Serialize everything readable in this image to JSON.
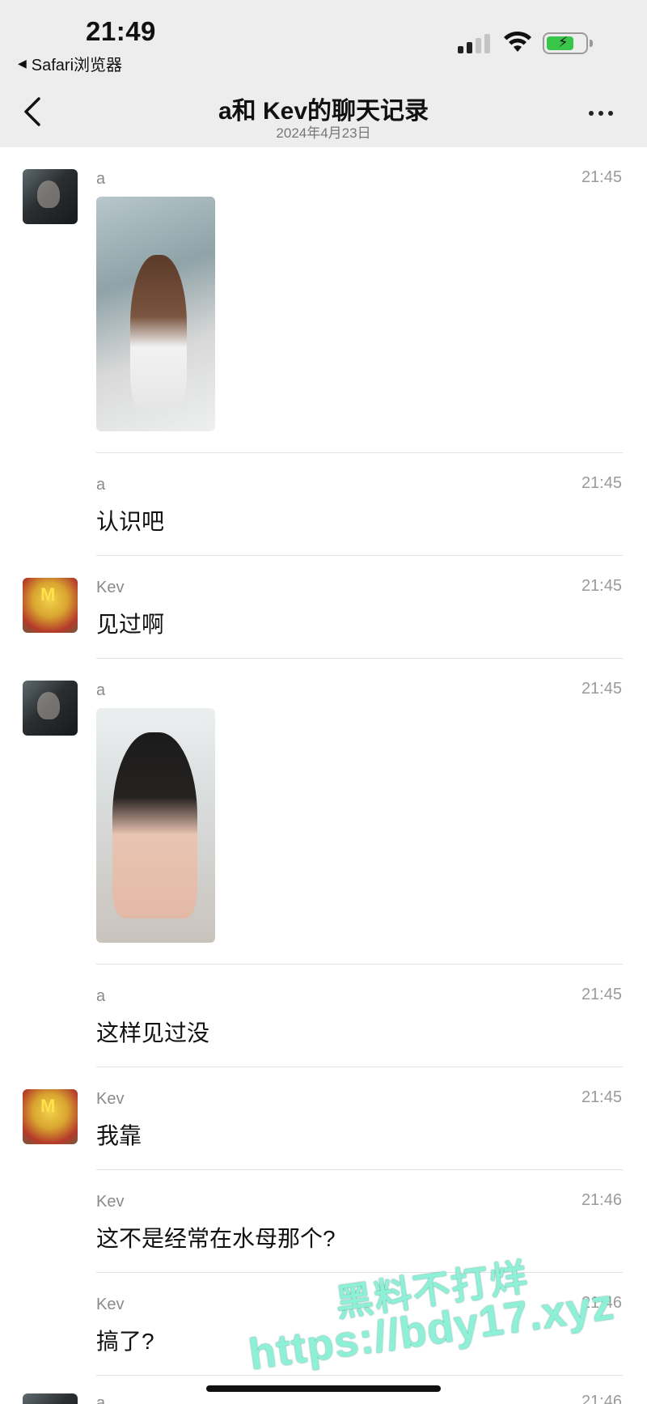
{
  "status_bar": {
    "time": "21:49",
    "back_app_label": "Safari浏览器",
    "battery_level_percent": 72,
    "signal_bars_active": 2,
    "signal_bars_total": 4
  },
  "nav": {
    "title": "a和 Kev的聊天记录",
    "subtitle": "2024年4月23日"
  },
  "messages": [
    {
      "sender": "a",
      "time": "21:45",
      "type": "image",
      "avatar": "a-avatar"
    },
    {
      "sender": "a",
      "time": "21:45",
      "type": "text",
      "text": "认识吧"
    },
    {
      "sender": "Kev",
      "time": "21:45",
      "type": "text",
      "text": "见过啊",
      "avatar": "kev-avatar"
    },
    {
      "sender": "a",
      "time": "21:45",
      "type": "image",
      "avatar": "a-avatar"
    },
    {
      "sender": "a",
      "time": "21:45",
      "type": "text",
      "text": "这样见过没"
    },
    {
      "sender": "Kev",
      "time": "21:45",
      "type": "text",
      "text": "我靠",
      "avatar": "kev-avatar"
    },
    {
      "sender": "Kev",
      "time": "21:46",
      "type": "text",
      "text": "这不是经常在水母那个?"
    },
    {
      "sender": "Kev",
      "time": "21:46",
      "type": "text",
      "text": "搞了?"
    },
    {
      "sender": "a",
      "time": "21:46",
      "type": "partial"
    }
  ],
  "watermark": {
    "line1": "黑料不打烊",
    "line2": "https://bdy17.xyz"
  },
  "colors": {
    "header_bg": "#ededed",
    "battery_green": "#39c44a",
    "watermark": "#8ef0d6"
  }
}
